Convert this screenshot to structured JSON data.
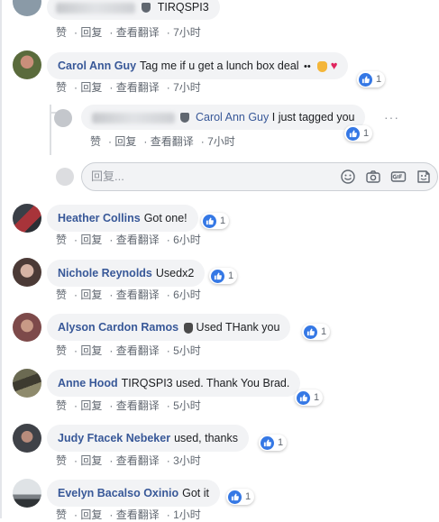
{
  "action_labels": {
    "like": "赞",
    "reply": "回复",
    "translate": "查看翻译"
  },
  "top_comment": {
    "text": "TIRQSPI3",
    "time": "7小时"
  },
  "comments": [
    {
      "author": "Carol Ann Guy",
      "text": "Tag me if u get a lunch box deal",
      "reactions": 1,
      "time": "7小时",
      "reply": {
        "mention": "Carol Ann Guy",
        "text": "I just tagged you",
        "reactions": 1,
        "time": "7小时"
      }
    },
    {
      "author": "Heather Collins",
      "text": "Got one!",
      "reactions": 1,
      "time": "6小时"
    },
    {
      "author": "Nichole Reynolds",
      "text": "Usedx2",
      "reactions": 1,
      "time": "6小时"
    },
    {
      "author": "Alyson Cardon Ramos",
      "text": "Used THank you",
      "reactions": 1,
      "time": "5小时"
    },
    {
      "author": "Anne Hood",
      "text": "TIRQSPI3 used. Thank You Brad.",
      "reactions": 1,
      "time": "5小时"
    },
    {
      "author": "Judy Ftacek Nebeker",
      "text": "used, thanks",
      "reactions": 1,
      "time": "3小时"
    },
    {
      "author": "Evelyn Bacalso Oxinio",
      "text": "Got it",
      "reactions": 1,
      "time": "1小时"
    }
  ],
  "reply_box": {
    "placeholder": "回复..."
  },
  "icons": {
    "reply_box": [
      "emoji-icon",
      "camera-icon",
      "gif-icon",
      "sticker-icon"
    ],
    "reaction": "like-icon"
  },
  "colors": {
    "author": "#385898",
    "like": "#3578e5",
    "heart": "#e0245e",
    "bubble": "#f2f3f5"
  }
}
